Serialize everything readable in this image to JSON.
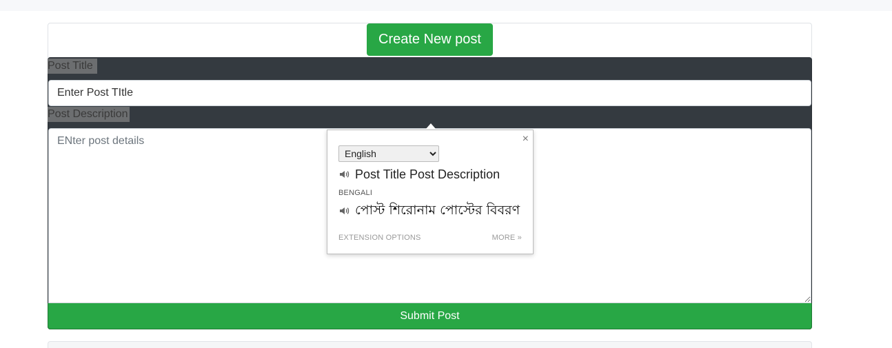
{
  "header": {
    "create_button": "Create New post"
  },
  "form": {
    "title_label": "Post Title",
    "title_value": "Enter Post TItle",
    "description_label": "Post Description",
    "description_placeholder": "ENter post details",
    "submit_label": "Submit Post"
  },
  "translate_popup": {
    "close_glyph": "×",
    "selected_language": "English",
    "source_text": "Post Title Post Description",
    "target_language": "BENGALI",
    "translated_text": "পোস্ট শিরোনাম পোস্টের বিবরণ",
    "extension_options": "EXTENSION OPTIONS",
    "more": "MORE »",
    "icons": {
      "speaker": "speaker-icon",
      "close": "close-icon"
    }
  },
  "colors": {
    "success": "#28a745",
    "panel_dark": "#343a40",
    "label_highlight": "#6c6e70"
  }
}
